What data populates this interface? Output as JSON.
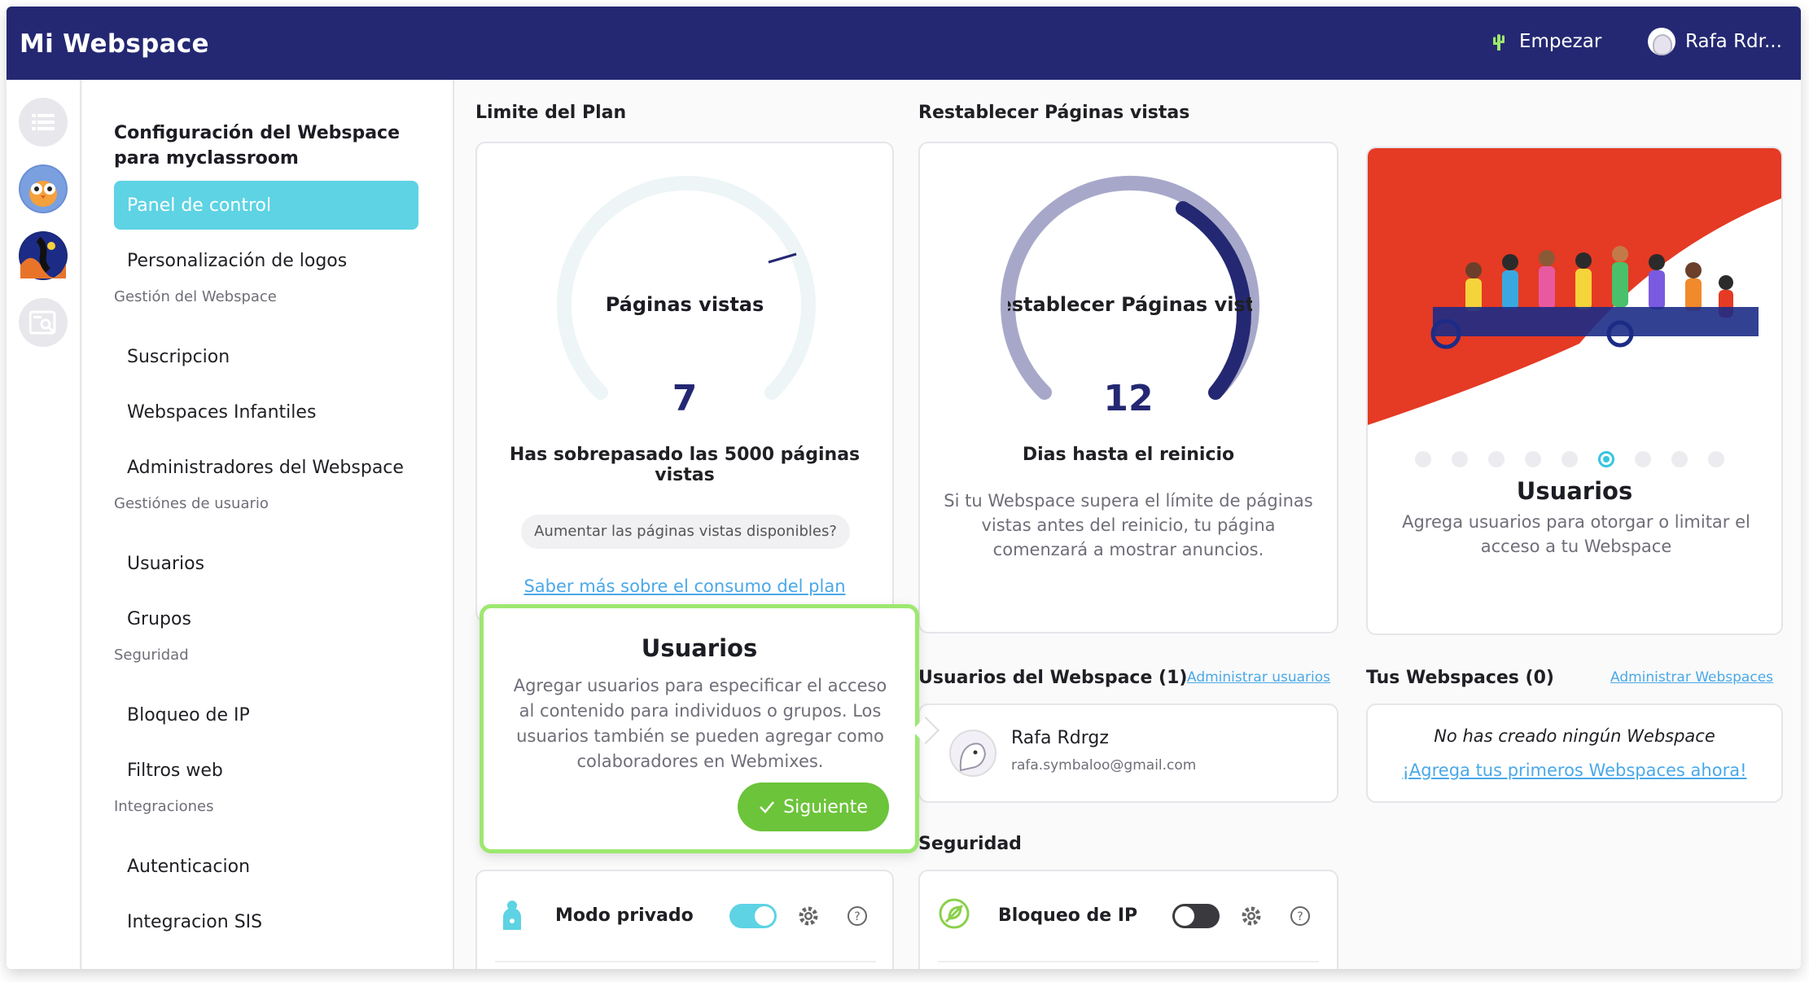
{
  "app": {
    "title": "Mi Webspace",
    "empezar_label": "Empezar",
    "user_name": "Rafa Rdr..."
  },
  "sidebar": {
    "title": "Configuración del Webspace para myclassroom",
    "active_item": "Panel de control",
    "items": [
      "Personalización de logos",
      "Suscripcion",
      "Webspaces Infantiles",
      "Administradores del Webspace",
      "Usuarios",
      "Grupos",
      "Bloqueo de IP",
      "Filtros web",
      "Autenticacion",
      "Integracion SIS"
    ],
    "sections": [
      "Gestión del Webspace",
      "Gestiónes de usuario",
      "Seguridad",
      "Integraciones"
    ]
  },
  "plan": {
    "heading": "Limite del Plan",
    "gauge_label": "Páginas vistas",
    "value": "7",
    "message": "Has sobrepasado las 5000 páginas vistas",
    "increase_button": "Aumentar las páginas vistas disponibles?",
    "learn_more_link": "Saber más sobre el consumo del plan"
  },
  "reset": {
    "heading": "Restablecer Páginas vistas",
    "gauge_label": "Restablecer Páginas vistas",
    "value": "12",
    "days_label": "Dias hasta el reinicio",
    "description": "Si tu Webspace supera el límite de páginas vistas antes del reinicio, tu página comenzará a mostrar anuncios."
  },
  "hero": {
    "title": "Usuarios",
    "subtitle": "Agrega usuarios para otorgar o limitar el acceso a tu Webspace",
    "active_slide": 6,
    "slide_count": 9
  },
  "tooltip": {
    "title": "Usuarios",
    "body": "Agregar usuarios para especificar el acceso al contenido para individuos o grupos. Los usuarios también se pueden agregar como colaboradores en Webmixes.",
    "button": "Siguiente"
  },
  "webspace_users": {
    "heading": "Usuarios del Webspace (1)",
    "manage_link": "Administrar usuarios",
    "user": {
      "name": "Rafa Rdrgz",
      "email": "rafa.symbaloo@gmail.com"
    }
  },
  "your_webspaces": {
    "heading": "Tus Webspaces (0)",
    "manage_link": "Administrar Webspaces",
    "empty_text": "No has creado ningún Webspace",
    "add_link": "¡Agrega tus primeros Webspaces ahora!"
  },
  "security": {
    "heading": "Seguridad",
    "private_mode": {
      "label": "Modo privado",
      "enabled": true
    },
    "ip_block": {
      "label": "Bloqueo de IP",
      "enabled": false
    }
  },
  "colors": {
    "topbar": "#242872",
    "accent": "#5dd3e4",
    "success": "#6cc43a",
    "gauge_dark": "#242872",
    "gauge_light": "#a7a8c9",
    "hero_red": "#e53a24"
  },
  "icons": {
    "empezar": "cactus-icon",
    "help": "question-circle-icon",
    "settings": "gear-icon",
    "private_mode": "person-icon",
    "ip_block": "shield-leaf-icon"
  }
}
